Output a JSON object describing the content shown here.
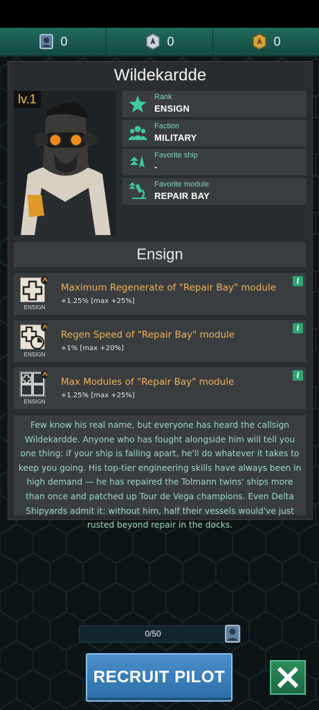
{
  "currencies": [
    {
      "icon": "pilot-card-icon",
      "value": "0"
    },
    {
      "icon": "ship-token-icon",
      "value": "0"
    },
    {
      "icon": "gold-token-icon",
      "value": "0"
    }
  ],
  "pilot": {
    "name": "Wildekardde",
    "level": "lv.1",
    "info": [
      {
        "icon": "star-icon",
        "label": "Rank",
        "value": "ENSIGN"
      },
      {
        "icon": "group-icon",
        "label": "Faction",
        "value": "MILITARY"
      },
      {
        "icon": "ship-icon",
        "label": "Favorite ship",
        "value": "-"
      },
      {
        "icon": "microscope-icon",
        "label": "Favorite module",
        "value": "REPAIR BAY"
      }
    ]
  },
  "rank_header": "Ensign",
  "bonuses": [
    {
      "icon": "repair-plus-icon",
      "rank": "ENSIGN",
      "title": "Maximum Regenerate of \"Repair Bay\" module",
      "desc": "+1.25% [max +25%]"
    },
    {
      "icon": "repair-speed-icon",
      "rank": "ENSIGN",
      "title": "Regen Speed of \"Repair Bay\" module",
      "desc": "+1% [max +20%]"
    },
    {
      "icon": "repair-modules-icon",
      "rank": "ENSIGN",
      "title": "Max Modules of \"Repair Bay\" module",
      "desc": "+1.25% [max +25%]"
    }
  ],
  "bio": "Few know his real name, but everyone has heard the callsign Wildekardde. Anyone who has fought alongside him will tell you one thing: if your ship is falling apart, he'll do whatever it takes to keep you going. His top-tier engineering skills have always been in high demand — he has repaired the Tolmann twins' ships more than once and patched up Tour de Vega champions. Even Delta Shipyards admit it: without him, half their vessels would've just rusted beyond repair in the docks.",
  "progress": {
    "text": "0/50",
    "fraction": 0
  },
  "recruit_label": "RECRUIT PILOT",
  "colors": {
    "accent": "#1f6a5c",
    "gold": "#f3b25c",
    "teal_text": "#9fd8c8",
    "button": "#2b6ea8"
  }
}
